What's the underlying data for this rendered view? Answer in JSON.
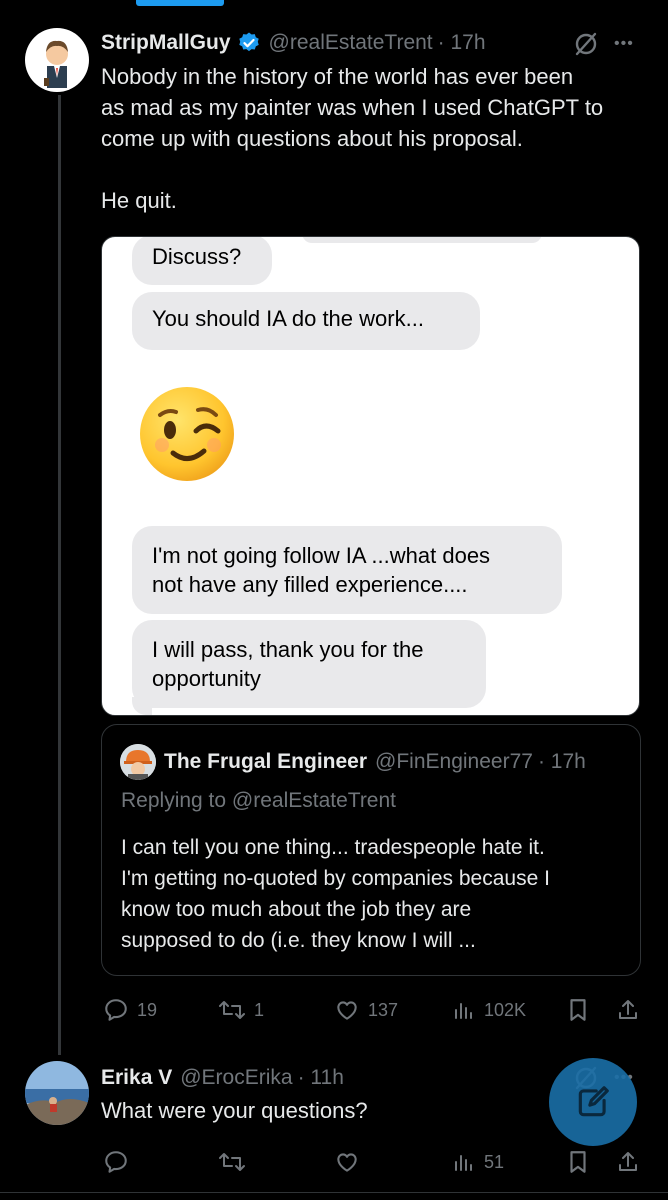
{
  "tweet": {
    "author_name": "StripMallGuy",
    "handle": "@realEstateTrent",
    "time": "· 17h",
    "text_lines": [
      "Nobody in the history of the world has ever been",
      "as mad as my painter was when I used ChatGPT to",
      "come up with questions about his proposal."
    ],
    "text_line_2": "He quit.",
    "image": {
      "bubbles": [
        "Discuss?",
        "You should IA do the work...",
        "I'm not going follow IA ...what does",
        "not have any filled experience....",
        "I will pass, thank you for the",
        "opportunity"
      ],
      "emoji": "😉"
    },
    "quote": {
      "author_name": "The Frugal Engineer",
      "handle": "@FinEngineer77",
      "time": "· 17h",
      "replying_to": "Replying to @realEstateTrent",
      "text_lines": [
        "I can tell you one thing... tradespeople hate it.",
        "I'm getting no-quoted by companies because I",
        "know too much about the job they are",
        "supposed to do (i.e. they know I will ..."
      ]
    },
    "actions": {
      "replies": "19",
      "reposts": "1",
      "likes": "137",
      "views": "102K"
    }
  },
  "reply": {
    "author_name": "Erika V",
    "handle": "@ErocErika",
    "time": "· 11h",
    "text": "What were your questions?",
    "actions": {
      "views": "51"
    }
  },
  "icons": {
    "more": "•••"
  },
  "colors": {
    "background": "#000000",
    "accent": "#1d9bf0",
    "muted": "#71767b",
    "bubble": "#e9e9eb"
  }
}
